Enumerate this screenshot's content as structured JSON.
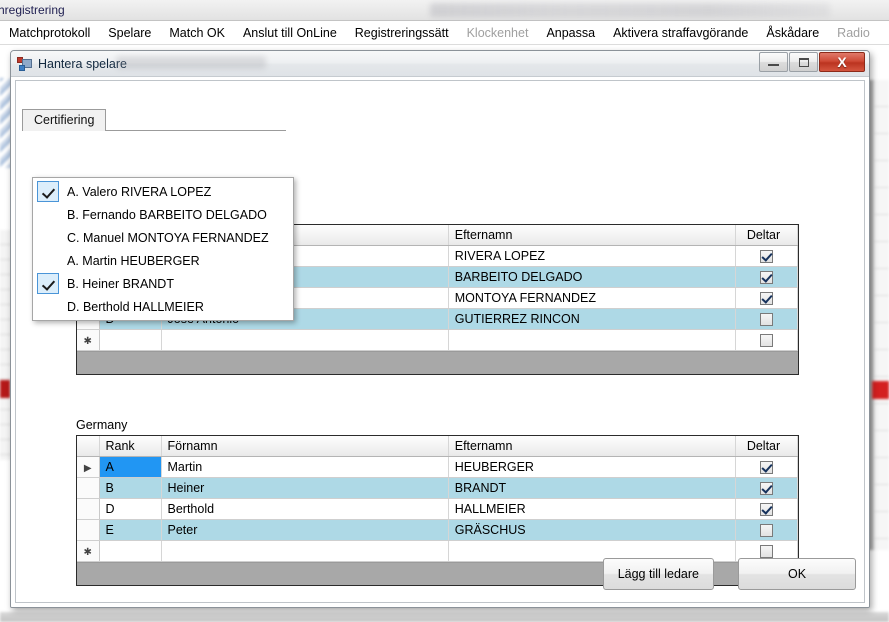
{
  "background_window": {
    "title": "chregistrering",
    "menu": [
      {
        "label": "Matchprotokoll",
        "disabled": false
      },
      {
        "label": "Spelare",
        "disabled": false
      },
      {
        "label": "Match OK",
        "disabled": false
      },
      {
        "label": "Anslut till OnLine",
        "disabled": false
      },
      {
        "label": "Registreringssätt",
        "disabled": false
      },
      {
        "label": "Klockenhet",
        "disabled": true
      },
      {
        "label": "Anpassa",
        "disabled": false
      },
      {
        "label": "Aktivera straffavgörande",
        "disabled": false
      },
      {
        "label": "Åskådare",
        "disabled": false
      },
      {
        "label": "Radio",
        "disabled": true
      }
    ]
  },
  "dialog": {
    "title": "Hantera spelare",
    "icon": "application-window-icon",
    "window_buttons": {
      "minimize": "minimize-icon",
      "maximize": "maximize-icon",
      "close": "X"
    },
    "tab": {
      "label": "Certifiering"
    },
    "dropdown": {
      "name": "certifiering-dropdown",
      "items": [
        {
          "label": "A. Valero RIVERA LOPEZ",
          "checked": true
        },
        {
          "label": "B. Fernando BARBEITO DELGADO",
          "checked": false
        },
        {
          "label": "C. Manuel MONTOYA FERNANDEZ",
          "checked": false
        },
        {
          "label": "A. Martin HEUBERGER",
          "checked": false
        },
        {
          "label": "B. Heiner BRANDT",
          "checked": true
        },
        {
          "label": "D. Berthold HALLMEIER",
          "checked": false
        }
      ]
    },
    "columns": [
      "",
      "Rank",
      "Förnamn",
      "Efternamn",
      "Deltar"
    ],
    "teams": [
      {
        "name": "",
        "rows": [
          {
            "marker": "",
            "rank": "A",
            "first": "Valero",
            "last": "RIVERA LOPEZ",
            "deltar": true,
            "alt": false,
            "selected": false
          },
          {
            "marker": "",
            "rank": "B",
            "first": "Fernando",
            "last": "BARBEITO DELGADO",
            "deltar": true,
            "alt": true,
            "selected": false
          },
          {
            "marker": "",
            "rank": "C",
            "first": "Manuel",
            "last": "MONTOYA FERNANDEZ",
            "deltar": true,
            "alt": false,
            "selected": false
          },
          {
            "marker": "",
            "rank": "D",
            "first": "Jose Antonio",
            "last": "GUTIERREZ RINCON",
            "deltar": false,
            "alt": true,
            "selected": false
          },
          {
            "marker": "✱",
            "rank": "",
            "first": "",
            "last": "",
            "deltar": false,
            "alt": false,
            "selected": false
          }
        ]
      },
      {
        "name": "Germany",
        "rows": [
          {
            "marker": "▶",
            "rank": "A",
            "first": "Martin",
            "last": "HEUBERGER",
            "deltar": true,
            "alt": false,
            "selected": true
          },
          {
            "marker": "",
            "rank": "B",
            "first": "Heiner",
            "last": "BRANDT",
            "deltar": true,
            "alt": true,
            "selected": false
          },
          {
            "marker": "",
            "rank": "D",
            "first": "Berthold",
            "last": "HALLMEIER",
            "deltar": true,
            "alt": false,
            "selected": false
          },
          {
            "marker": "",
            "rank": "E",
            "first": "Peter",
            "last": "GRÄSCHUS",
            "deltar": false,
            "alt": true,
            "selected": false
          },
          {
            "marker": "✱",
            "rank": "",
            "first": "",
            "last": "",
            "deltar": false,
            "alt": false,
            "selected": false
          }
        ]
      }
    ],
    "footer": {
      "add_leader_label": "Lägg till ledare",
      "ok_label": "OK"
    }
  },
  "colors": {
    "row_alt": "#aed9e6",
    "row_selected": "#2196f3",
    "close_button": "#cf4a36",
    "grid_filler": "#a8a8a8",
    "dropdown_check_bg": "#dceefb"
  }
}
